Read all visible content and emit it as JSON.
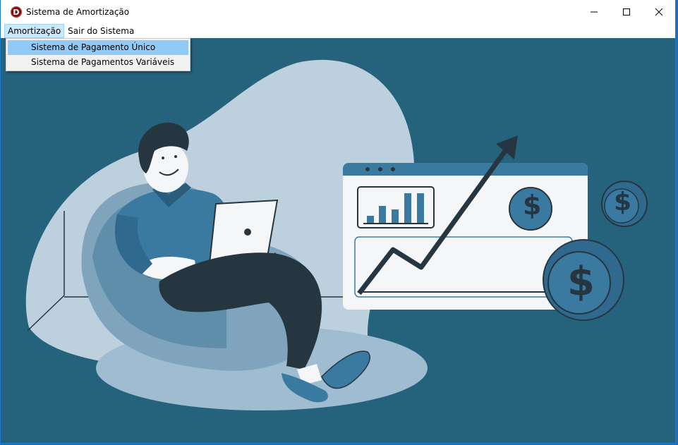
{
  "window": {
    "title": "Sistema de Amortização",
    "app_icon_letter": "D"
  },
  "menubar": {
    "items": [
      {
        "label": "Amortização"
      },
      {
        "label": "Sair do Sistema"
      }
    ]
  },
  "dropdown": {
    "items": [
      {
        "label": "Sistema de Pagamento Único"
      },
      {
        "label": "Sistema de Pagamentos Variáveis"
      }
    ]
  },
  "illustration": {
    "coin_symbol": "$",
    "colors": {
      "background": "#25627c",
      "blob": "#bcd0de",
      "dark": "#263640",
      "mid": "#3b7aa0",
      "white": "#f4f6f8"
    }
  }
}
